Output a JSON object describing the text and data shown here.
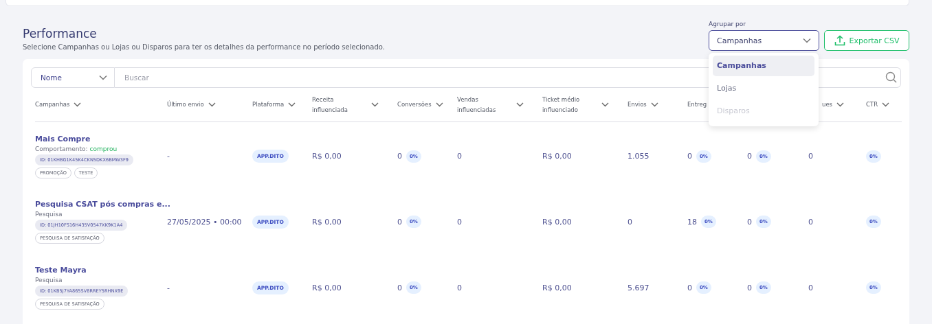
{
  "section": {
    "title": "Performance",
    "subtitle": "Selecione Campanhas ou Lojas ou Disparos para ter os detalhes da performance no período selecionado."
  },
  "group_by": {
    "label": "Agrupar por",
    "value": "Campanhas",
    "expanded": true,
    "options": [
      {
        "label": "Campanhas",
        "selected": true,
        "disabled": false
      },
      {
        "label": "Lojas",
        "selected": false,
        "disabled": false
      },
      {
        "label": "Disparos",
        "selected": false,
        "disabled": true
      }
    ]
  },
  "export_button": "Exportar CSV",
  "search": {
    "filter": "Nome",
    "placeholder": "Buscar"
  },
  "table": {
    "columns": [
      {
        "label": "Campanhas"
      },
      {
        "label": "Último envio"
      },
      {
        "label": "Plataforma"
      },
      {
        "label": "Receita influenciada"
      },
      {
        "label": "Conversões"
      },
      {
        "label": "Vendas influenciadas"
      },
      {
        "label": "Ticket médio influenciado"
      },
      {
        "label": "Envios"
      },
      {
        "label": "Entreg"
      },
      {},
      {
        "label": "ues"
      },
      {
        "label": "CTR"
      }
    ],
    "rows": [
      {
        "name": "Mais Compre",
        "subtitle": "Comportamento:",
        "subtitle_highlight": "comprou",
        "id": "ID: 01KHBG1K45K4CKN5DKX6BMW3F9",
        "tags": [
          "PROMOÇÃO",
          "TESTE"
        ],
        "last_send": "-",
        "platform": "APP.DITO",
        "revenue": "R$ 0,00",
        "conversions": {
          "value": "0",
          "pct": "0%"
        },
        "sales": "0",
        "ticket": "R$ 0,00",
        "sends": "1.055",
        "deliveries": {
          "value": "0",
          "pct": "0%"
        },
        "column_10": {
          "value": "0",
          "pct": "0%"
        },
        "column_11": "0",
        "ctr": "0%"
      },
      {
        "name": "Pesquisa CSAT pós compras e...",
        "subtitle": "Pesquisa",
        "id": "ID: 01JH10FS16H435V0547XK9K1A4",
        "tags": [
          "PESQUISA DE SATISFAÇÃO"
        ],
        "last_send": "27/05/2025 • 00:00",
        "platform": "APP.DITO",
        "revenue": "R$ 0,00",
        "conversions": {
          "value": "0",
          "pct": "0%"
        },
        "sales": "0",
        "ticket": "R$ 0,00",
        "sends": "0",
        "deliveries": {
          "value": "18",
          "pct": "0%"
        },
        "column_10": {
          "value": "0",
          "pct": "0%"
        },
        "column_11": "0",
        "ctr": "0%"
      },
      {
        "name": "Teste Mayra",
        "subtitle": "Pesquisa",
        "id": "ID: 01KB5J7YA865SV8RREY5RHNX9E",
        "tags": [
          "PESQUISA DE SATISFAÇÃO"
        ],
        "last_send": "-",
        "platform": "APP.DITO",
        "revenue": "R$ 0,00",
        "conversions": {
          "value": "0",
          "pct": "0%"
        },
        "sales": "0",
        "ticket": "R$ 0,00",
        "sends": "5.697",
        "deliveries": {
          "value": "0",
          "pct": "0%"
        },
        "column_10": {
          "value": "0",
          "pct": "0%"
        },
        "column_11": "0",
        "ctr": "0%"
      }
    ]
  }
}
